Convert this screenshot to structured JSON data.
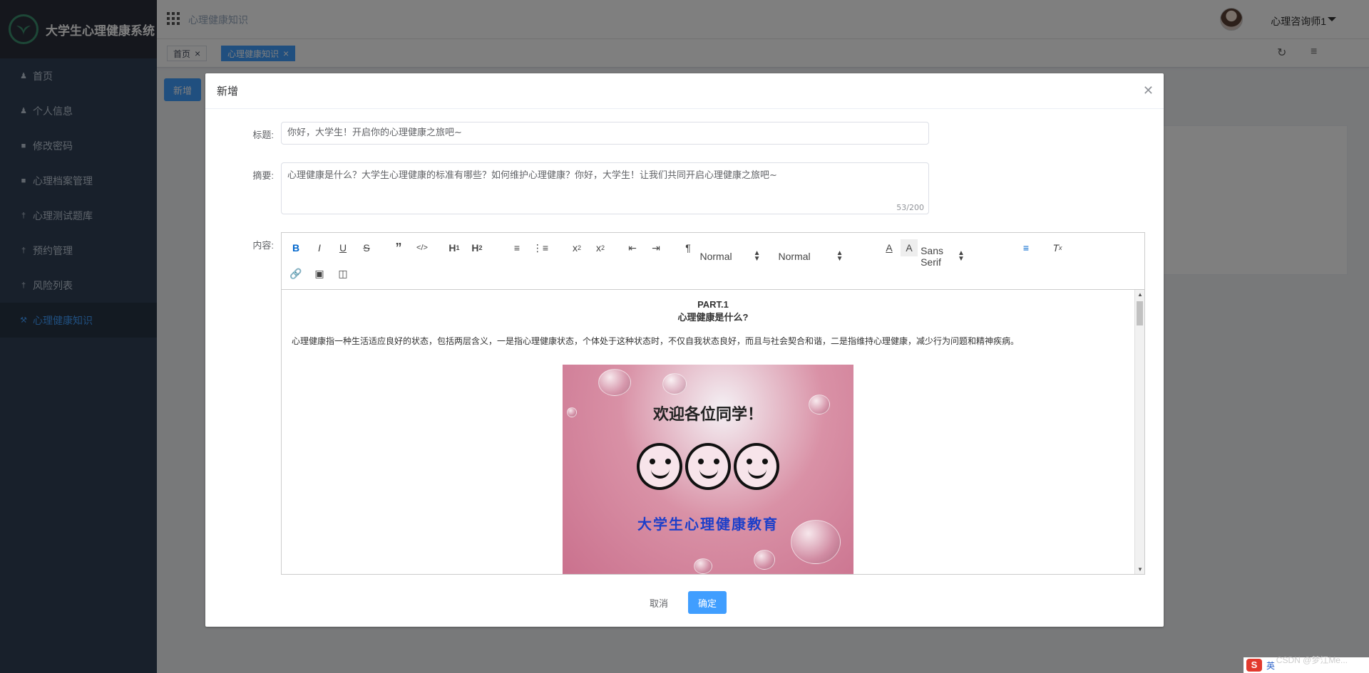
{
  "app": {
    "title": "大学生心理健康系统"
  },
  "sidebar": {
    "items": [
      {
        "label": "首页",
        "icon": "user-icon"
      },
      {
        "label": "个人信息",
        "icon": "user-icon"
      },
      {
        "label": "修改密码",
        "icon": "lock-icon"
      },
      {
        "label": "心理档案管理",
        "icon": "lock-icon"
      },
      {
        "label": "心理测试题库",
        "icon": "person-icon"
      },
      {
        "label": "预约管理",
        "icon": "person-icon"
      },
      {
        "label": "风险列表",
        "icon": "person-icon"
      },
      {
        "label": "心理健康知识",
        "icon": "wrench-icon",
        "active": true
      }
    ]
  },
  "header": {
    "breadcrumb": "心理健康知识",
    "user_name": "心理咨询师1"
  },
  "tags": [
    {
      "label": "首页"
    },
    {
      "label": "心理健康知识",
      "active": true
    }
  ],
  "page": {
    "add_label": "新增"
  },
  "dialog": {
    "title": "新增",
    "fields": {
      "title_label": "标题:",
      "title_value": "你好，大学生！开启你的心理健康之旅吧~",
      "abstract_label": "摘要:",
      "abstract_value": "心理健康是什么？大学生心理健康的标准有哪些？如何维护心理健康？你好，大学生！让我们共同开启心理健康之旅吧~",
      "abstract_count": "53/200",
      "content_label": "内容:"
    },
    "toolbar": {
      "header_select": "Normal",
      "size_select": "Normal",
      "font_select": "Sans Serif"
    },
    "content": {
      "part": "PART.1",
      "heading": "心理健康是什么?",
      "paragraph": "心理健康指一种生活适应良好的状态，包括两层含义，一是指心理健康状态，个体处于这种状态时，不仅自我状态良好，而且与社会契合和谐，二是指维持心理健康，减少行为问题和精神疾病。",
      "image_text_1": "欢迎各位同学！",
      "image_text_2": "大学生心理健康教育"
    },
    "footer": {
      "cancel": "取消",
      "confirm": "确定"
    }
  },
  "taskbar": {
    "ime": "英",
    "watermark": "CSDN @梦江Me..."
  },
  "colors": {
    "primary": "#409eff",
    "sidebar_bg": "#304156",
    "active_text": "#409eff"
  }
}
